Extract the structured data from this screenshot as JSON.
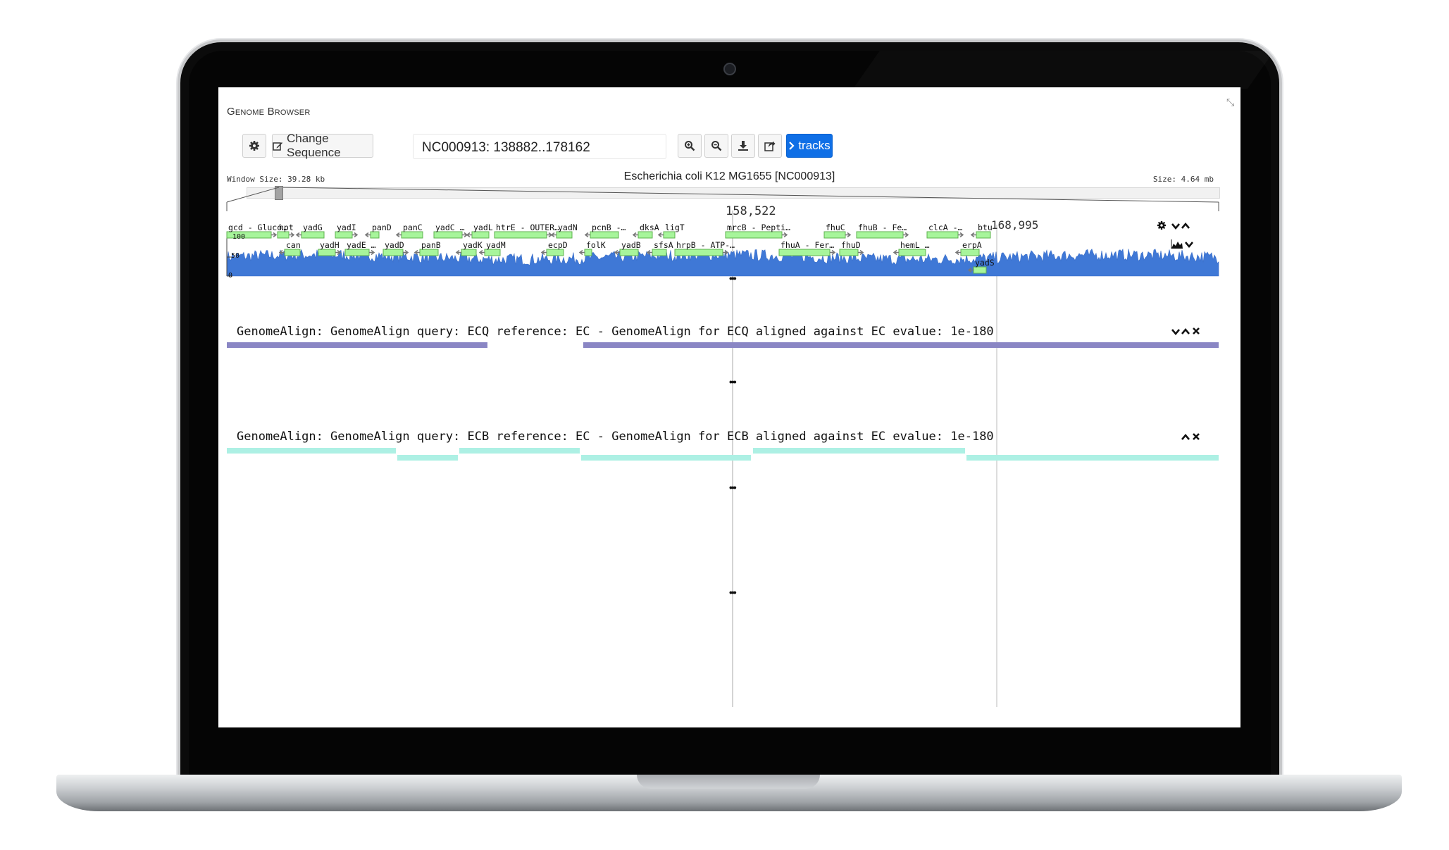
{
  "app": {
    "title": "Genome Browser",
    "sequence_button_label": "Change Sequence",
    "location": "NC000913: 138882..178162",
    "tracks_button_label": "tracks",
    "window_size": "Window Size: 39.28 kb",
    "sequence_name": "Escherichia coli K12 MG1655 [NC000913]",
    "genome_size": "Size: 4.64 mb"
  },
  "ruler": {
    "center_coord": "158,522",
    "marker_coord": "168,995"
  },
  "gc_track": {
    "max_label": "100",
    "mid_label": "50",
    "min_label": "0",
    "color": "#3f78d6"
  },
  "gene_track": {
    "color": "#a7f59b",
    "genes": [
      {
        "label": "gcd - Gluco…",
        "strand": "+",
        "row": 0
      },
      {
        "label": "hpt",
        "strand": "+",
        "row": 0
      },
      {
        "label": "yadG",
        "strand": "-",
        "row": 0
      },
      {
        "label": "yadI",
        "strand": "+",
        "row": 0
      },
      {
        "label": "panD",
        "strand": "-",
        "row": 0
      },
      {
        "label": "panC",
        "strand": "-",
        "row": 0
      },
      {
        "label": "yadC …",
        "strand": "+",
        "row": 0
      },
      {
        "label": "yadL",
        "strand": "-",
        "row": 0
      },
      {
        "label": "htrE - OUTER…",
        "strand": "+",
        "row": 0
      },
      {
        "label": "yadN",
        "strand": "-",
        "row": 0
      },
      {
        "label": "pcnB -…",
        "strand": "-",
        "row": 0
      },
      {
        "label": "dksA",
        "strand": "-",
        "row": 0
      },
      {
        "label": "ligT",
        "strand": "-",
        "row": 0
      },
      {
        "label": "mrcB - Pepti…",
        "strand": "+",
        "row": 0
      },
      {
        "label": "fhuC",
        "strand": "+",
        "row": 0
      },
      {
        "label": "fhuB - Fe…",
        "strand": "+",
        "row": 0
      },
      {
        "label": "clcA -…",
        "strand": "+",
        "row": 0
      },
      {
        "label": "btu",
        "strand": "-",
        "row": 0
      },
      {
        "label": "can",
        "strand": "-",
        "row": 1
      },
      {
        "label": "yadH",
        "strand": "+",
        "row": 1
      },
      {
        "label": "yadE …",
        "strand": "+",
        "row": 1
      },
      {
        "label": "yadD",
        "strand": "+",
        "row": 1
      },
      {
        "label": "panB",
        "strand": "-",
        "row": 1
      },
      {
        "label": "yadK",
        "strand": "-",
        "row": 1
      },
      {
        "label": "yadM",
        "strand": "-",
        "row": 1
      },
      {
        "label": "ecpD",
        "strand": "-",
        "row": 1
      },
      {
        "label": "folK",
        "strand": "-",
        "row": 1
      },
      {
        "label": "yadB",
        "strand": "-",
        "row": 1
      },
      {
        "label": "sfsA",
        "strand": "-",
        "row": 1
      },
      {
        "label": "hrpB - ATP-…",
        "strand": "+",
        "row": 1
      },
      {
        "label": "fhuA - Fer…",
        "strand": "+",
        "row": 1
      },
      {
        "label": "fhuD",
        "strand": "+",
        "row": 1
      },
      {
        "label": "hemL …",
        "strand": "-",
        "row": 1
      },
      {
        "label": "erpA",
        "strand": "-",
        "row": 1
      },
      {
        "label": "yadS",
        "strand": "-",
        "row": 2
      }
    ]
  },
  "align_tracks": [
    {
      "label": "GenomeAlign: GenomeAlign query: ECQ reference: EC - GenomeAlign for ECQ aligned against EC evalue: 1e-180",
      "color": "#8a86c4"
    },
    {
      "label": "GenomeAlign: GenomeAlign query: ECB reference: EC - GenomeAlign for ECB aligned against EC evalue: 1e-180",
      "color": "#adf0e4"
    }
  ]
}
